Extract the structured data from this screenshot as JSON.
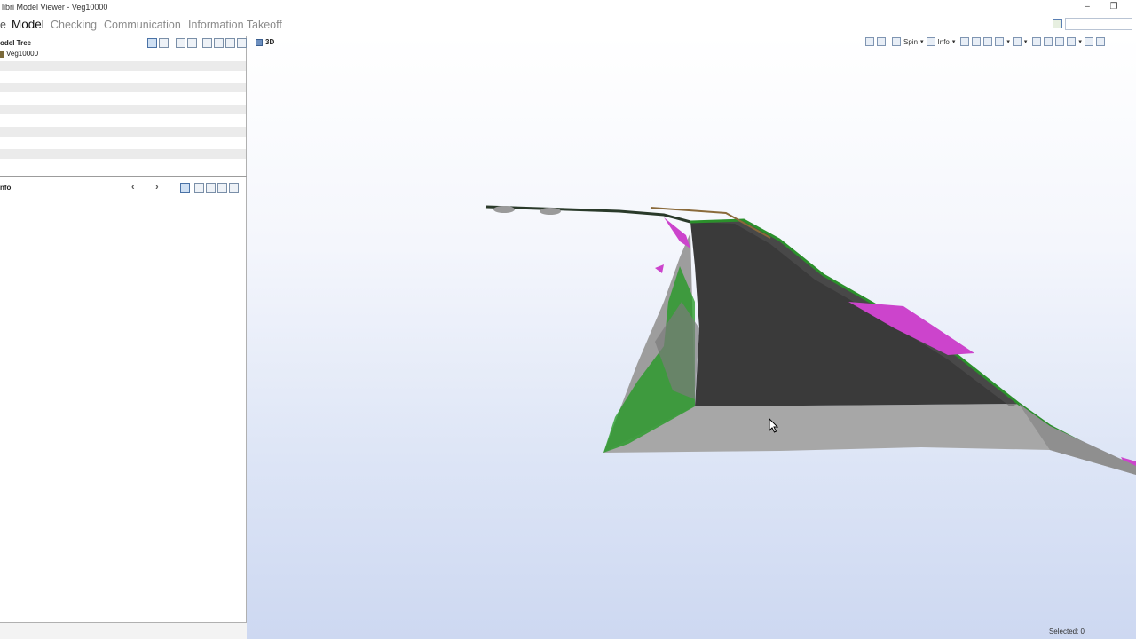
{
  "window": {
    "title": "libri Model Viewer - Veg10000",
    "minimize_glyph": "–",
    "restore_glyph": "❐"
  },
  "menu": {
    "items": [
      "Model",
      "Checking",
      "Communication",
      "Information Takeoff"
    ],
    "partial_left": "e"
  },
  "model_tree": {
    "title": "odel Tree",
    "root_node": "Veg10000"
  },
  "info_panel": {
    "title": "nfo",
    "back_glyph": "‹",
    "forward_glyph": "›"
  },
  "viewport": {
    "mode_label": "3D",
    "spin_label": "Spin",
    "info_label": "Info",
    "status_text": "Selected: 0"
  },
  "icons": [
    "search-icon",
    "cube-icon",
    "undo-icon",
    "redo-icon",
    "spin-icon",
    "info-icon",
    "zoom-icon",
    "settings-icon",
    "node-icon"
  ],
  "colors": {
    "road_surface": "#3a3a3a",
    "embankment": "#a8a8a8",
    "vegetation": "#1f9a1f",
    "magenta_surface": "#cc44cc",
    "sky_bottom": "#cdd8f1"
  }
}
